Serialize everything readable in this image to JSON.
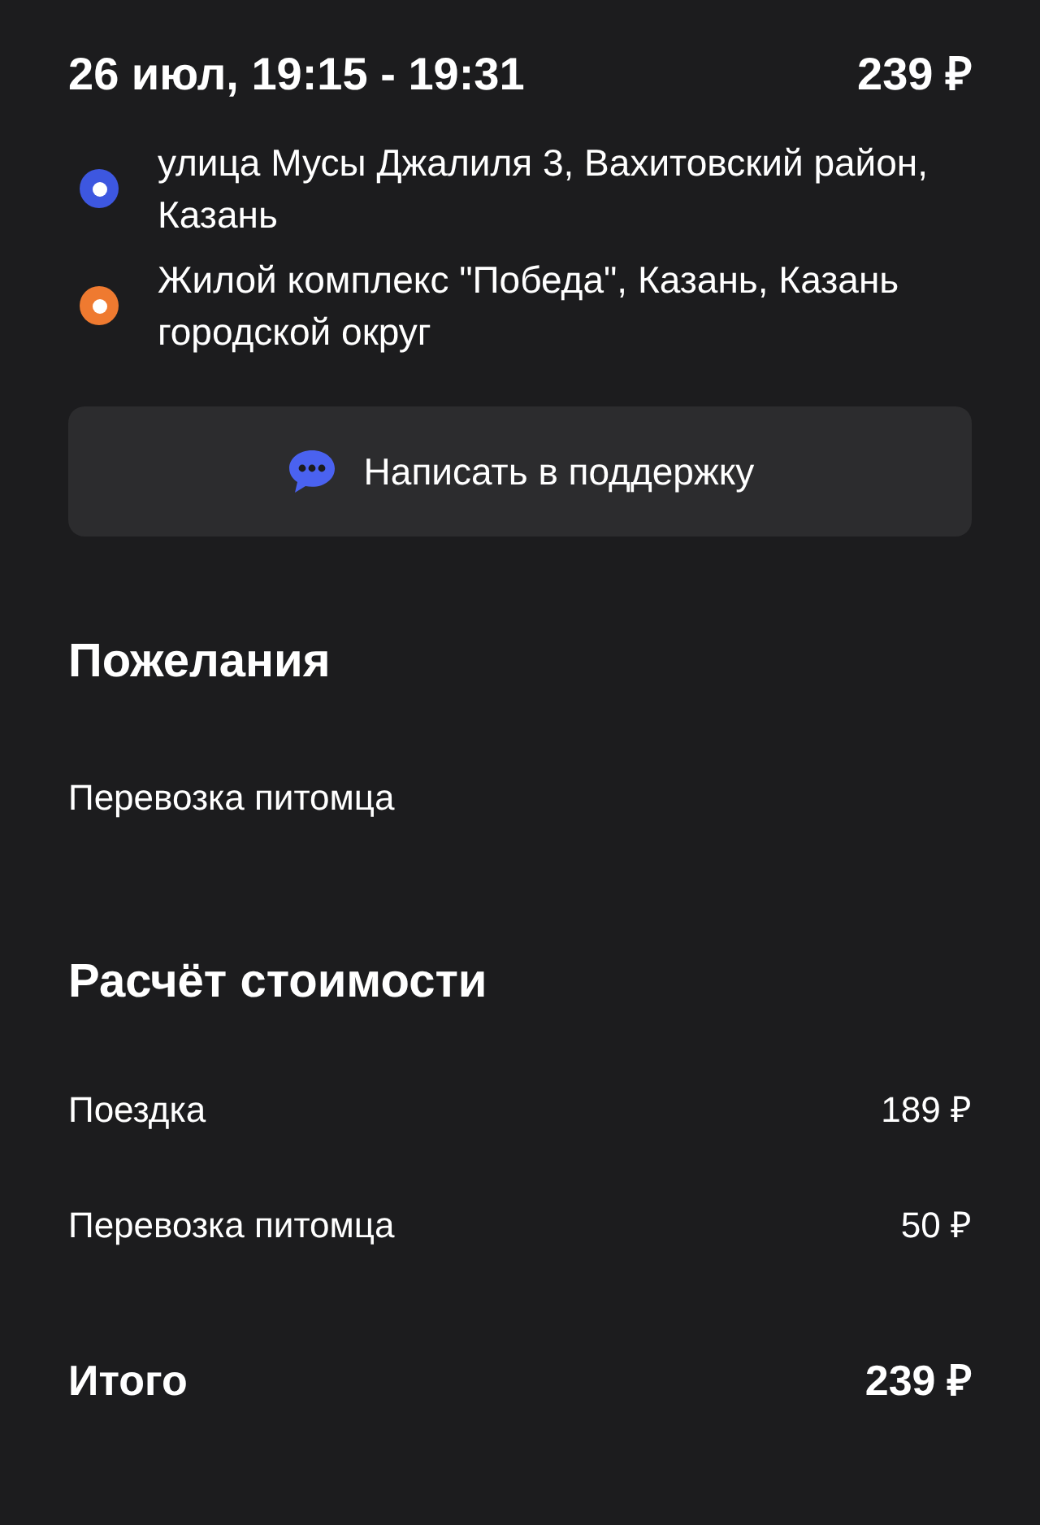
{
  "trip": {
    "datetime": "26 июл, 19:15 - 19:31",
    "price": "239 ₽"
  },
  "route": [
    {
      "address": "улица Мусы Джалиля 3, Вахитовский район, Казань",
      "color": "#3d57e0"
    },
    {
      "address": "Жилой комплекс \"Победа\", Казань, Казань городской округ",
      "color": "#ef7a30"
    }
  ],
  "support_button": "Написать в поддержку",
  "wishes": {
    "title": "Пожелания",
    "items": [
      "Перевозка питомца"
    ]
  },
  "cost": {
    "title": "Расчёт стоимости",
    "rows": [
      {
        "label": "Поездка",
        "amount": "189 ₽"
      },
      {
        "label": "Перевозка питомца",
        "amount": "50 ₽"
      }
    ],
    "total": {
      "label": "Итого",
      "amount": "239 ₽"
    }
  }
}
